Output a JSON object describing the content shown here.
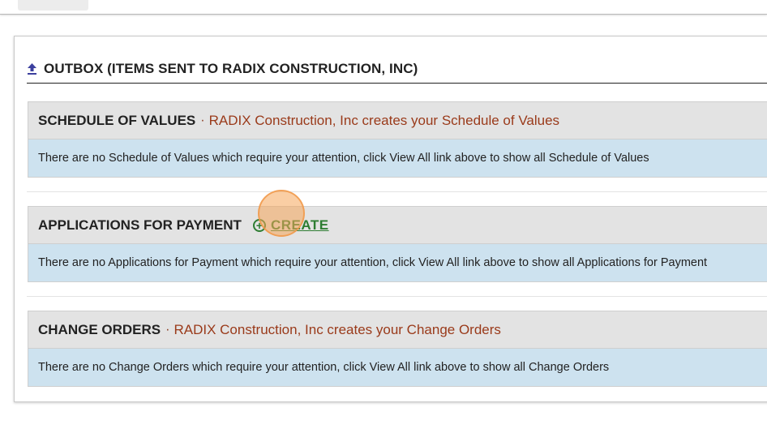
{
  "outbox": {
    "title": "OUTBOX (ITEMS SENT TO RADIX CONSTRUCTION, INC)"
  },
  "sections": {
    "schedule_of_values": {
      "title": "SCHEDULE OF VALUES",
      "separator": "·",
      "subtitle": "RADIX Construction, Inc creates your Schedule of Values",
      "message": "There are no Schedule of Values which require your attention, click View All link above to show all Schedule of Values"
    },
    "applications_for_payment": {
      "title": "APPLICATIONS FOR PAYMENT",
      "create_label": "CREATE",
      "message": "There are no Applications for Payment which require your attention, click View All link above to show all Applications for Payment"
    },
    "change_orders": {
      "title": "CHANGE ORDERS",
      "separator": "·",
      "subtitle": "RADIX Construction, Inc creates your Change Orders",
      "message": "There are no Change Orders which require your attention, click View All link above to show all Change Orders"
    }
  },
  "colors": {
    "header_bg": "#e3e3e3",
    "body_bg": "#cde2ef",
    "subtitle": "#9a3a1a",
    "create": "#2e7d32",
    "icon": "#3b3f9e"
  },
  "icons": {
    "outbox": "upload-icon",
    "create": "plus-circle-icon"
  }
}
